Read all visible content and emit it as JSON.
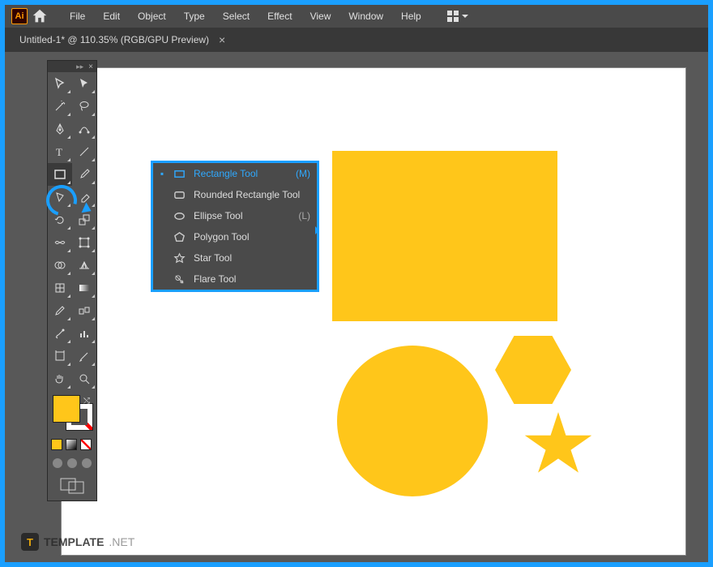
{
  "app": {
    "logo_text": "Ai"
  },
  "menubar": {
    "items": [
      "File",
      "Edit",
      "Object",
      "Type",
      "Select",
      "Effect",
      "View",
      "Window",
      "Help"
    ]
  },
  "tab": {
    "title": "Untitled-1* @ 110.35% (RGB/GPU Preview)",
    "close": "×"
  },
  "tools": {
    "names": [
      "selection-tool",
      "direct-selection-tool",
      "magic-wand-tool",
      "lasso-tool",
      "pen-tool",
      "curvature-tool",
      "type-tool",
      "line-segment-tool",
      "rectangle-tool",
      "paintbrush-tool",
      "shaper-tool",
      "eraser-tool",
      "rotate-tool",
      "scale-tool",
      "width-tool",
      "free-transform-tool",
      "shape-builder-tool",
      "perspective-grid-tool",
      "mesh-tool",
      "gradient-tool",
      "eyedropper-tool",
      "blend-tool",
      "symbol-sprayer-tool",
      "column-graph-tool",
      "artboard-tool",
      "slice-tool",
      "hand-tool",
      "zoom-tool"
    ]
  },
  "flyout": {
    "items": [
      {
        "label": "Rectangle Tool",
        "key": "(M)",
        "selected": true,
        "icon": "rectangle-icon"
      },
      {
        "label": "Rounded Rectangle Tool",
        "key": "",
        "selected": false,
        "icon": "rounded-rectangle-icon"
      },
      {
        "label": "Ellipse Tool",
        "key": "(L)",
        "selected": false,
        "icon": "ellipse-icon"
      },
      {
        "label": "Polygon Tool",
        "key": "",
        "selected": false,
        "icon": "polygon-icon"
      },
      {
        "label": "Star Tool",
        "key": "",
        "selected": false,
        "icon": "star-icon"
      },
      {
        "label": "Flare Tool",
        "key": "",
        "selected": false,
        "icon": "flare-icon"
      }
    ]
  },
  "colors": {
    "shape_fill": "#ffc61a",
    "accent": "#1a9fff"
  },
  "watermark": {
    "logo": "T",
    "bold": "TEMPLATE",
    "light": ".NET"
  }
}
